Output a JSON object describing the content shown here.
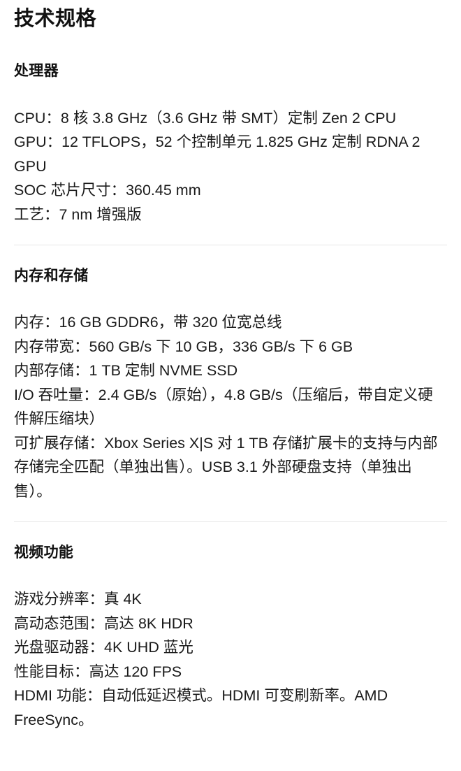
{
  "document": {
    "title": "技术规格",
    "background_color": "#ffffff",
    "text_color": "#1a1a1a",
    "divider_color": "#e6e6e6"
  },
  "sections": [
    {
      "id": "processor",
      "heading": "处理器",
      "lines": [
        "CPU：8 核 3.8 GHz（3.6 GHz 带 SMT）定制 Zen 2 CPU",
        "GPU：12 TFLOPS，52 个控制单元 1.825 GHz 定制 RDNA 2 GPU",
        "SOC 芯片尺寸：360.45 mm",
        "工艺：7 nm 增强版"
      ]
    },
    {
      "id": "memory-and-storage",
      "heading": "内存和存储",
      "lines": [
        "内存：16 GB GDDR6，带 320 位宽总线",
        "内存带宽：560 GB/s 下 10 GB，336 GB/s 下 6 GB",
        "内部存储：1 TB 定制 NVME SSD",
        "I/O 吞吐量：2.4 GB/s（原始），4.8 GB/s（压缩后，带自定义硬件解压缩块）",
        "可扩展存储：Xbox Series X|S 对 1 TB 存储扩展卡的支持与内部存储完全匹配（单独出售）。USB 3.1 外部硬盘支持（单独出售）。"
      ]
    },
    {
      "id": "video-capabilities",
      "heading": "视频功能",
      "lines": [
        "游戏分辨率：真 4K",
        "高动态范围：高达 8K HDR",
        "光盘驱动器：4K UHD 蓝光",
        "性能目标：高达 120 FPS",
        "HDMI 功能：自动低延迟模式。HDMI 可变刷新率。AMD FreeSync。"
      ]
    }
  ]
}
